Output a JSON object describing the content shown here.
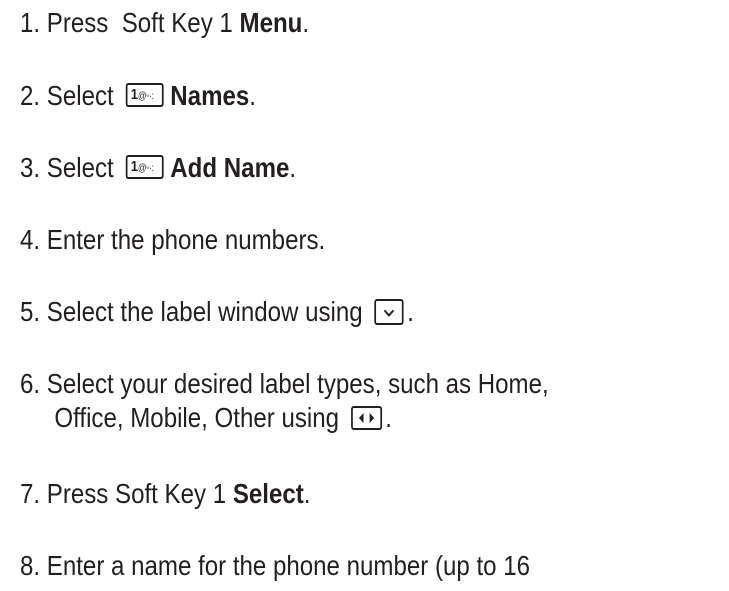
{
  "steps": [
    {
      "number": "1.",
      "text_before": "Press  Soft Key 1 ",
      "bold": "Menu",
      "text_after": "."
    },
    {
      "number": "2.",
      "text_before": "Select ",
      "key": "1",
      "key_symbols": "@ᵕ·:",
      "bold": "Names",
      "text_after": "."
    },
    {
      "number": "3.",
      "text_before": "Select ",
      "key": "1",
      "key_symbols": "@ᵕ·:",
      "bold": "Add Name",
      "text_after": "."
    },
    {
      "number": "4.",
      "text": "Enter the phone numbers."
    },
    {
      "number": "5.",
      "text_before": "Select the label window using ",
      "icon": "down-navigation-key-icon",
      "text_after": "."
    },
    {
      "number": "6.",
      "line1": "Select your desired label types, such as Home,",
      "line2_before": "Office, Mobile, Other using ",
      "icon": "left-right-navigation-key-icon",
      "line2_after": "."
    },
    {
      "number": "7.",
      "text_before": "Press Soft Key 1 ",
      "bold": "Select",
      "text_after": "."
    },
    {
      "number": "8.",
      "text": "Enter a name for the phone number (up to 16"
    }
  ]
}
